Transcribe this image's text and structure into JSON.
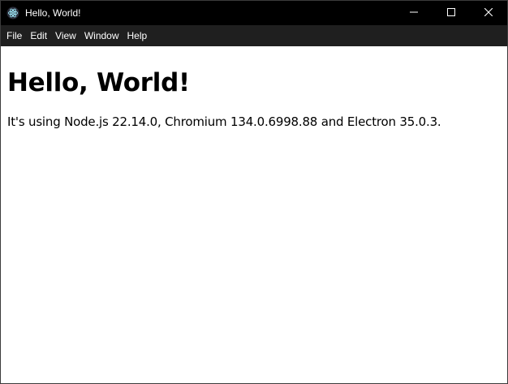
{
  "window": {
    "title": "Hello, World!",
    "app_icon": "electron-icon",
    "controls": {
      "minimize_icon": "minimize-icon",
      "maximize_icon": "maximize-icon",
      "close_icon": "close-icon"
    }
  },
  "menubar": {
    "items": [
      {
        "label": "File"
      },
      {
        "label": "Edit"
      },
      {
        "label": "View"
      },
      {
        "label": "Window"
      },
      {
        "label": "Help"
      }
    ]
  },
  "main": {
    "heading": "Hello, World!",
    "info": "It's using Node.js 22.14.0, Chromium 134.0.6998.88 and Electron 35.0.3."
  },
  "colors": {
    "titlebar_bg": "#000000",
    "menubar_bg": "#1f1f1f",
    "content_bg": "#ffffff",
    "text": "#000000"
  }
}
